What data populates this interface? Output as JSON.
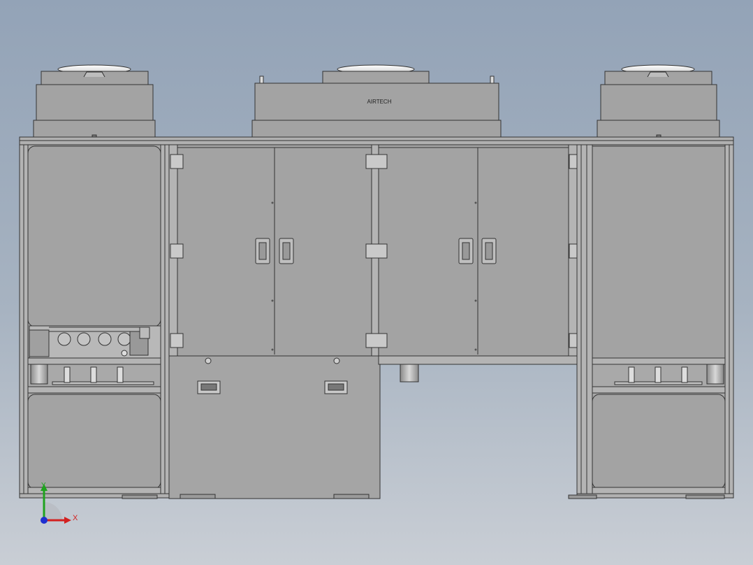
{
  "viewport": {
    "background_top": "#93a3b7",
    "background_bottom": "#c9ced5"
  },
  "cad_model": {
    "brand_label": "AIRTECH",
    "panel_color": "#a3a3a3",
    "frame_color": "#9e9e9e",
    "line_color": "#333333"
  },
  "triad": {
    "x_label": "X",
    "y_label": "Y",
    "x_color": "#d32020",
    "y_color": "#1fa31f",
    "origin_color": "#1f2fd0"
  }
}
